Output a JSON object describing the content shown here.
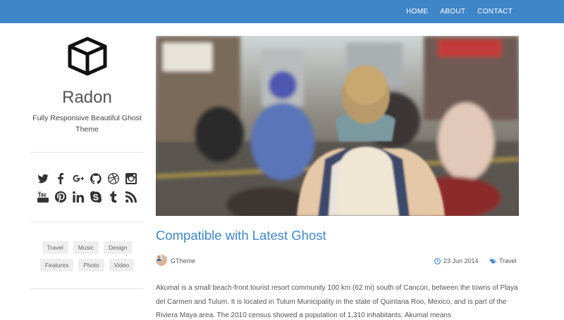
{
  "nav": {
    "items": [
      "HOME",
      "ABOUT",
      "CONTACT"
    ]
  },
  "brand": {
    "accent_color": "#3f86c9"
  },
  "sidebar": {
    "logo_icon": "cube-icon",
    "title": "Radon",
    "description": "Fully Responsive Beautiful Ghost Theme",
    "social_icons": [
      "twitter-icon",
      "facebook-icon",
      "google-plus-icon",
      "github-icon",
      "dribbble-icon",
      "instagram-icon",
      "youtube-icon",
      "pinterest-icon",
      "linkedin-icon",
      "skype-icon",
      "tumblr-icon",
      "rss-icon"
    ],
    "tags": [
      "Travel",
      "Music",
      "Design",
      "Features",
      "Photo",
      "Video"
    ]
  },
  "post": {
    "title": "Compatible with Latest Ghost",
    "author": "GTheme",
    "date": "23 Jun 2014",
    "category": "Travel",
    "excerpt": "Akumal is a small beach-front tourist resort community 100 km (62 mi) south of Cancún, between the towns of Playa del Carmen and Tulum. It is located in Tulum Municipality in the state of Quintana Roo, Mexico, and is part of the Riviera Maya area. The 2010 census showed a population of 1,310 inhabitants. Akumal means"
  }
}
